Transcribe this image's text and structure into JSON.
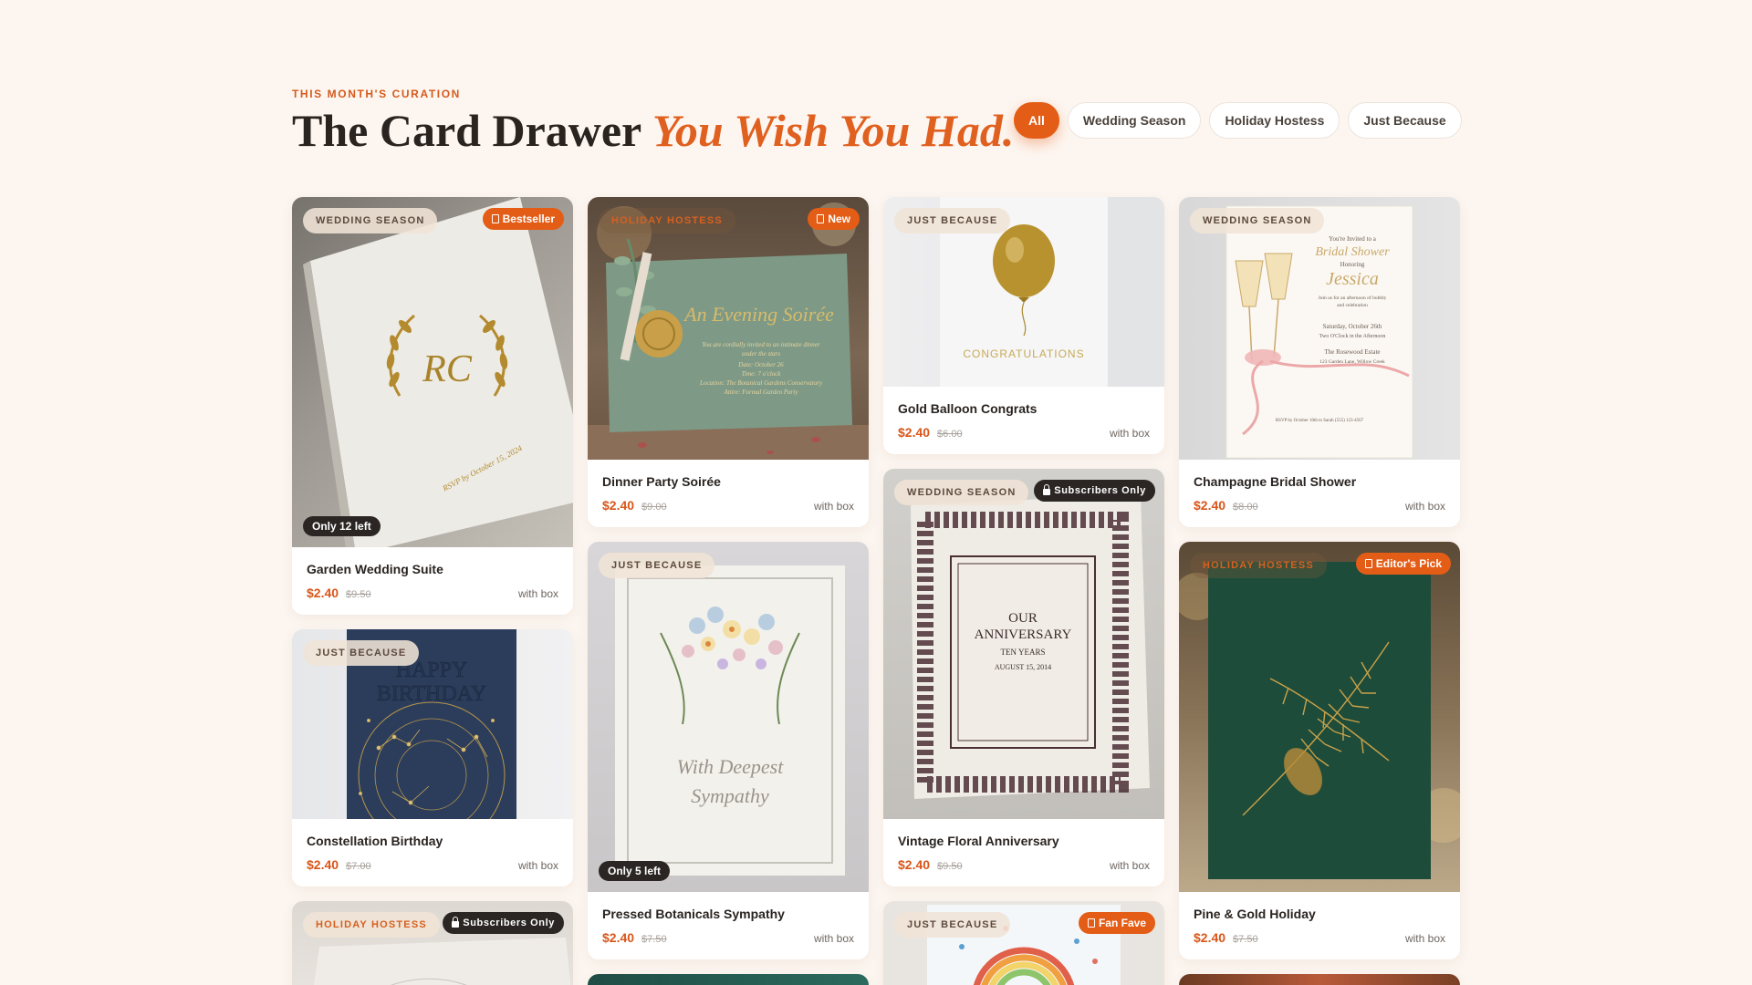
{
  "header": {
    "eyebrow": "THIS MONTH'S CURATION",
    "title_main": "The Card Drawer",
    "title_accent": "You Wish You Had."
  },
  "filters": [
    "All",
    "Wedding Season",
    "Holiday Hostess",
    "Just Because"
  ],
  "products": [
    {
      "title": "Garden Wedding Suite",
      "price": "$2.40",
      "original_price": "$9.50",
      "box": "with box",
      "category": "WEDDING SEASON",
      "badge": "Bestseller",
      "stock": "Only 12 left",
      "art": {
        "monogram": "RC",
        "rsvp": "RSVP by October 15, 2024"
      }
    },
    {
      "title": "Dinner Party Soirée",
      "price": "$2.40",
      "original_price": "$9.00",
      "box": "with box",
      "category": "HOLIDAY HOSTESS",
      "badge": "New",
      "art": {
        "script": "An Evening Soirée",
        "lines": [
          "You are cordially invited to an intimate dinner",
          "under the stars",
          "Date: October 26",
          "Time: 7 o'clock",
          "Location: The Botanical Gardens Conservatory",
          "Attire: Formal Garden Party"
        ]
      }
    },
    {
      "title": "Gold Balloon Congrats",
      "price": "$2.40",
      "original_price": "$6.00",
      "box": "with box",
      "category": "JUST BECAUSE",
      "art": {
        "text": "CONGRATULATIONS"
      }
    },
    {
      "title": "Champagne Bridal Shower",
      "price": "$2.40",
      "original_price": "$8.00",
      "box": "with box",
      "category": "WEDDING SEASON",
      "art": {
        "l1": "You're Invited to a",
        "l2": "Bridal Shower",
        "l3": "Honoring",
        "l4": "Jessica",
        "l5": "Join us for an afternoon of bubbly",
        "l6": "and celebration",
        "l7": "Saturday, October 26th",
        "l8": "Two O'Clock in the Afternoon",
        "l9": "The Rosewood Estate",
        "l10": "123 Garden Lane, Willow Creek",
        "l11": "RSVP by October 10th to Sarah (555) 123-4567"
      }
    },
    {
      "title": "Constellation Birthday",
      "price": "$2.40",
      "original_price": "$7.00",
      "box": "with box",
      "category": "JUST BECAUSE",
      "art": {
        "l1": "HAPPY",
        "l2": "BIRTHDAY"
      }
    },
    {
      "title": "Pressed Botanicals Sympathy",
      "price": "$2.40",
      "original_price": "$7.50",
      "box": "with box",
      "category": "JUST BECAUSE",
      "stock": "Only 5 left",
      "art": {
        "l1": "With Deepest",
        "l2": "Sympathy"
      }
    },
    {
      "title": "Vintage Floral Anniversary",
      "price": "$2.40",
      "original_price": "$9.50",
      "box": "with box",
      "category": "WEDDING SEASON",
      "badge": "Subscribers Only",
      "art": {
        "l1": "OUR",
        "l2": "ANNIVERSARY",
        "l3": "TEN YEARS",
        "l4": "AUGUST 15, 2014"
      }
    },
    {
      "title": "Pine & Gold Holiday",
      "price": "$2.40",
      "original_price": "$7.50",
      "box": "with box",
      "category": "HOLIDAY HOSTESS",
      "badge": "Editor's Pick"
    },
    {
      "category": "HOLIDAY HOSTESS",
      "badge": "Subscribers Only"
    },
    {
      "category": "JUST BECAUSE",
      "badge": "Fan Fave"
    }
  ],
  "colors": {
    "accent": "#e45d16",
    "background": "#fdf6f0",
    "dark_badge": "#2b2624"
  }
}
